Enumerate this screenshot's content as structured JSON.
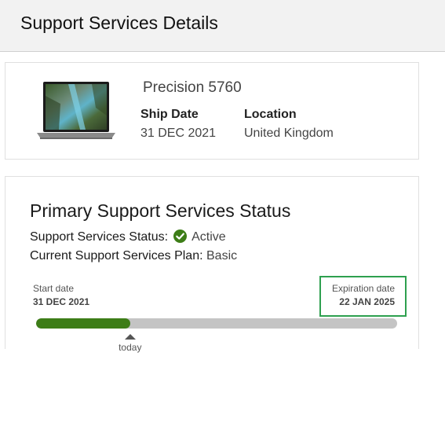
{
  "header": {
    "title": "Support Services Details"
  },
  "product": {
    "name": "Precision 5760",
    "ship_date_label": "Ship Date",
    "ship_date": "31 DEC 2021",
    "location_label": "Location",
    "location": "United Kingdom",
    "image_icon": "laptop-image"
  },
  "status": {
    "title": "Primary Support Services Status",
    "status_label": "Support Services Status:",
    "status_value": "Active",
    "status_icon": "check-circle-icon",
    "plan_label": "Current Support Services Plan:",
    "plan_value": "Basic",
    "start_label": "Start date",
    "start_date": "31 DEC 2021",
    "expiration_label": "Expiration date",
    "expiration_date": "22 JAN 2025",
    "progress_fraction": 0.26,
    "today_label": "today"
  },
  "colors": {
    "accent_green": "#3d7d17",
    "highlight_box": "#2ea04f",
    "track_gray": "#c4c4c4"
  }
}
